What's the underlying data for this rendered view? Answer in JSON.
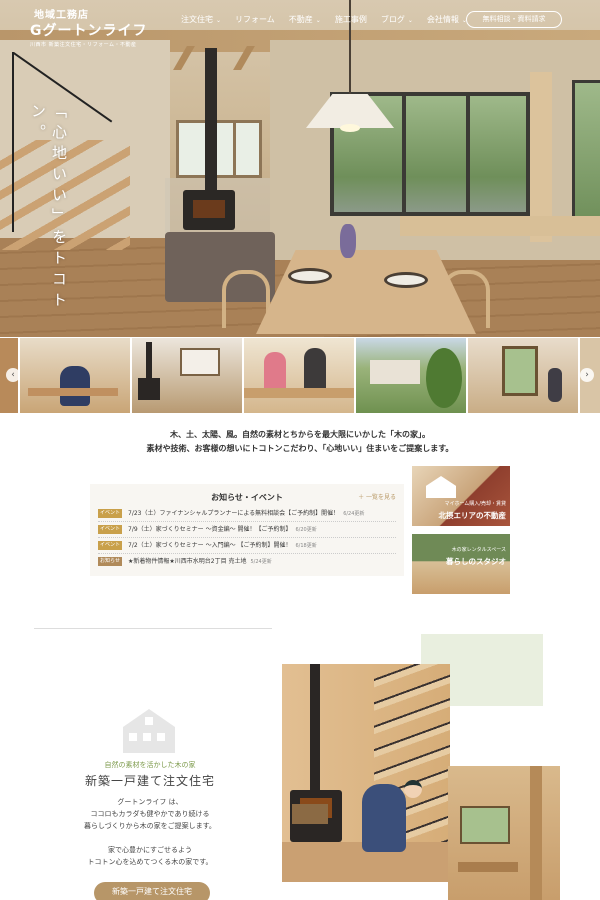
{
  "brand": {
    "sup": "地域工務店",
    "name": "グートンライフ",
    "tagline": "川西市 新築注文住宅・リフォーム・不動産"
  },
  "nav": {
    "items": [
      {
        "label": "注文住宅",
        "has_dropdown": true
      },
      {
        "label": "リフォーム",
        "has_dropdown": false
      },
      {
        "label": "不動産",
        "has_dropdown": true
      },
      {
        "label": "施工事例",
        "has_dropdown": false
      },
      {
        "label": "ブログ",
        "has_dropdown": true
      },
      {
        "label": "会社情報",
        "has_dropdown": true
      }
    ],
    "cta": "無料相談・資料請求"
  },
  "hero": {
    "copy": "「心地いい」をトコトン。"
  },
  "carousel": {
    "prev": "‹",
    "next": "›"
  },
  "intro": {
    "line1": "木、土、太陽、風。自然の素材とちからを最大限にいかした「木の家」。",
    "line2": "素材や技術、お客様の想いにトコトンこだわり、「心地いい」住まいをご提案します。"
  },
  "news": {
    "title": "お知らせ・イベント",
    "more": "＋ 一覧を見る",
    "items": [
      {
        "tag": "イベント",
        "tag_color": "#c9a04a",
        "text": "7/23（土）ファイナンシャルプランナーによる無料相談会【ご予約制】開催！",
        "date": "6/24更新"
      },
      {
        "tag": "イベント",
        "tag_color": "#c9a04a",
        "text": "7/9（土）家づくりセミナー ～資金編～ 開催！【ご予約制】",
        "date": "6/20更新"
      },
      {
        "tag": "イベント",
        "tag_color": "#c9a04a",
        "text": "7/2（土）家づくりセミナー ～入門編～ 【ご予約制】開催！",
        "date": "6/18更新"
      },
      {
        "tag": "お知らせ",
        "tag_color": "#b08a5a",
        "text": "★新着物件情報★川西市水明台2丁目 売土地",
        "date": "5/24更新"
      }
    ]
  },
  "banners": [
    {
      "small": "マイホーム購入/売却・賃貸",
      "label": "北摂エリアの不動産"
    },
    {
      "small": "木の家レンタルスペース",
      "label": "暮らしのスタジオ"
    }
  ],
  "section": {
    "catch": "自然の素材を活かした木の家",
    "title": "新築一戸建て注文住宅",
    "body1": "グートンライフ は、",
    "body2": "ココロもカラダも健やかであり続ける",
    "body3": "暮らしづくりから木の家をご提案します。",
    "body4": "家で心豊かにすごせるよう",
    "body5": "トコトン心を込めてつくる木の家です。",
    "button": "新築一戸建て注文住宅"
  },
  "colors": {
    "accent": "#b79668",
    "event_tag": "#c9a04a",
    "green": "#7c9a4a"
  }
}
